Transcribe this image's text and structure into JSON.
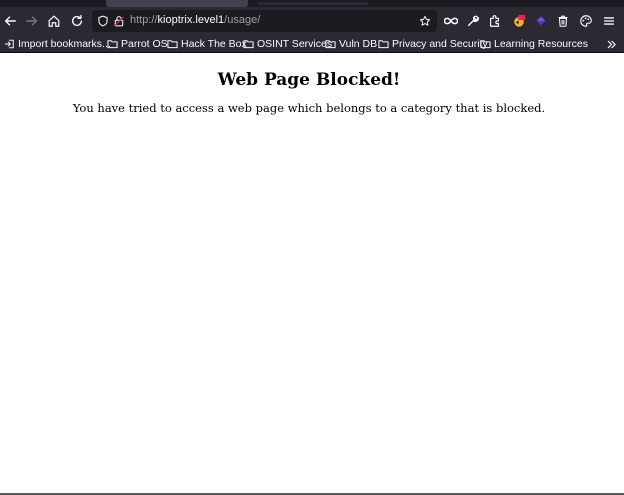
{
  "browser": {
    "nav": {
      "back_icon": "arrow-left-icon",
      "forward_icon": "arrow-right-icon",
      "home_icon": "home-icon",
      "reload_icon": "reload-icon"
    },
    "urlbar": {
      "scheme": "http://",
      "host": "kioptrix.level1",
      "path": "/usage/",
      "shield_icon": "shield-icon",
      "security_icon": "insecure-lock-icon",
      "bookmark_icon": "star-icon"
    },
    "toolbar_icons": [
      "infinity-icon",
      "wrench-icon",
      "extensions-icon",
      "extension-badge-icon",
      "extension-diamond-icon",
      "trash-icon",
      "palette-icon",
      "menu-icon"
    ],
    "bookmarks": [
      {
        "label": "Import bookmarks...",
        "icon": "import-icon"
      },
      {
        "label": "Parrot OS",
        "icon": "folder-icon"
      },
      {
        "label": "Hack The Box",
        "icon": "folder-icon"
      },
      {
        "label": "OSINT Services",
        "icon": "folder-icon"
      },
      {
        "label": "Vuln DB",
        "icon": "folder-icon"
      },
      {
        "label": "Privacy and Security",
        "icon": "folder-icon"
      },
      {
        "label": "Learning Resources",
        "icon": "folder-icon"
      }
    ],
    "colors": {
      "chrome_bg": "#2b2a33",
      "tabstrip_bg": "#1c1b22",
      "urlbar_bg": "#1c1b22",
      "insecure_icon": "#e22850",
      "page_bg": "#ffffff"
    }
  },
  "page": {
    "heading": "Web Page Blocked!",
    "message": "You have tried to access a web page which belongs to a category that is blocked."
  }
}
